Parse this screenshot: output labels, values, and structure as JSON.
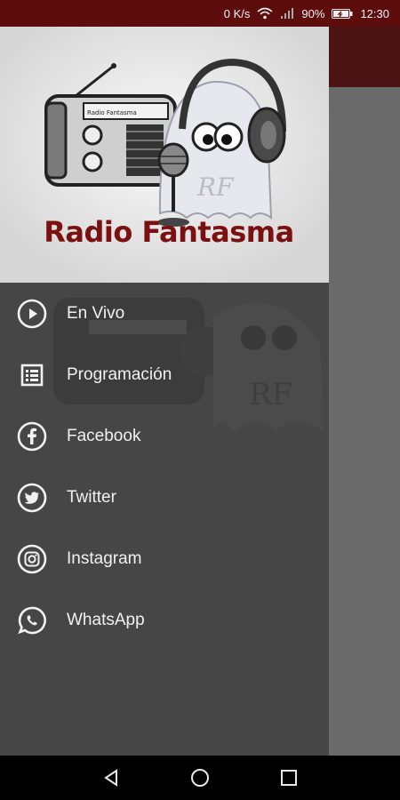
{
  "status_bar": {
    "speed": "0 K/s",
    "battery": "90%",
    "time": "12:30",
    "icons": [
      "wifi-icon",
      "signal-icon",
      "battery-icon"
    ]
  },
  "drawer": {
    "header": {
      "brand_name": "Radio Fantasma",
      "logo_monogram": "RF",
      "radio_dial_text": "Radio Fantasma"
    },
    "menu": [
      {
        "label": "En Vivo",
        "icon": "play-circle-icon"
      },
      {
        "label": "Programación",
        "icon": "list-icon"
      },
      {
        "label": "Facebook",
        "icon": "facebook-icon"
      },
      {
        "label": "Twitter",
        "icon": "twitter-icon"
      },
      {
        "label": "Instagram",
        "icon": "instagram-icon"
      },
      {
        "label": "WhatsApp",
        "icon": "whatsapp-icon"
      }
    ]
  },
  "nav_bar": {
    "buttons": [
      "back-icon",
      "home-icon",
      "recents-icon"
    ]
  },
  "colors": {
    "status_bar": "#5e0d0d",
    "toolbar": "#4b1313",
    "drawer": "#464646",
    "brand_red": "#7a1010",
    "menu_text": "#f1f1f1"
  }
}
